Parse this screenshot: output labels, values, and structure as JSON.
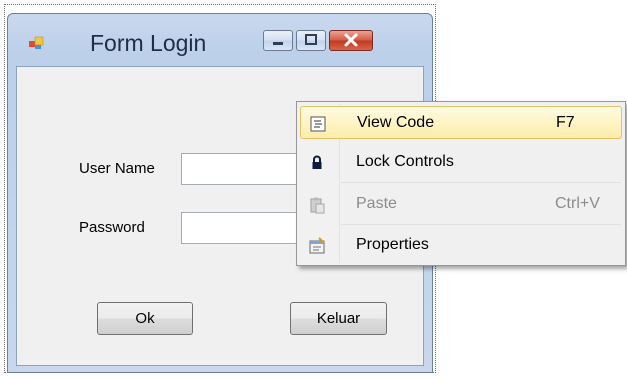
{
  "window": {
    "title": "Form Login"
  },
  "form": {
    "username_label": "User Name",
    "password_label": "Password",
    "username_value": "",
    "password_value": "",
    "ok_label": "Ok",
    "exit_label": "Keluar"
  },
  "context_menu": {
    "items": [
      {
        "label": "View Code",
        "shortcut": "F7",
        "icon": "view-code-icon",
        "highlighted": true,
        "enabled": true
      },
      {
        "label": "Lock Controls",
        "shortcut": "",
        "icon": "lock-icon",
        "highlighted": false,
        "enabled": true
      },
      {
        "label": "Paste",
        "shortcut": "Ctrl+V",
        "icon": "paste-icon",
        "highlighted": false,
        "enabled": false
      },
      {
        "label": "Properties",
        "shortcut": "",
        "icon": "properties-icon",
        "highlighted": false,
        "enabled": true
      }
    ]
  },
  "colors": {
    "highlight": "#fdeca9",
    "close_button": "#c0391f",
    "window_frame": "#bcd0ea"
  }
}
